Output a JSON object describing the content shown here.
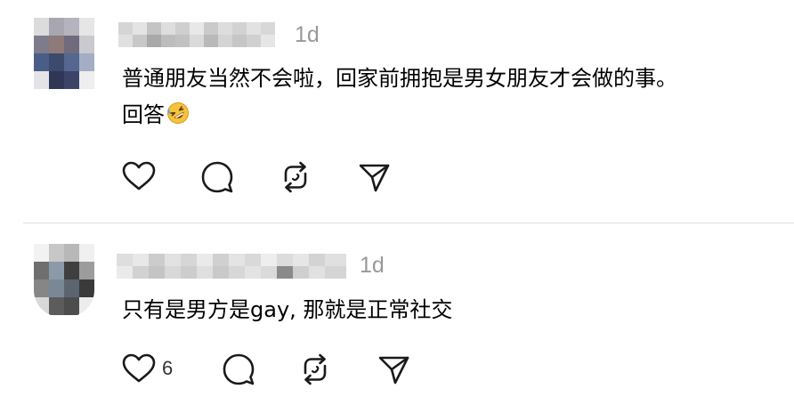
{
  "posts": [
    {
      "timestamp": "1d",
      "text_line1": "普通朋友当然不会啦，回家前拥抱是男女朋友才会做的事。",
      "text_line2": "回答",
      "emoji": "rolling-on-floor-laughing-emoji",
      "like_count": ""
    },
    {
      "timestamp": "1d",
      "text_line1": "只有是男方是gay, 那就是正常社交",
      "like_count": "6"
    }
  ],
  "icons": {
    "like": "heart-icon",
    "comment": "comment-bubble-icon",
    "repost": "repost-icon",
    "share": "send-icon"
  }
}
